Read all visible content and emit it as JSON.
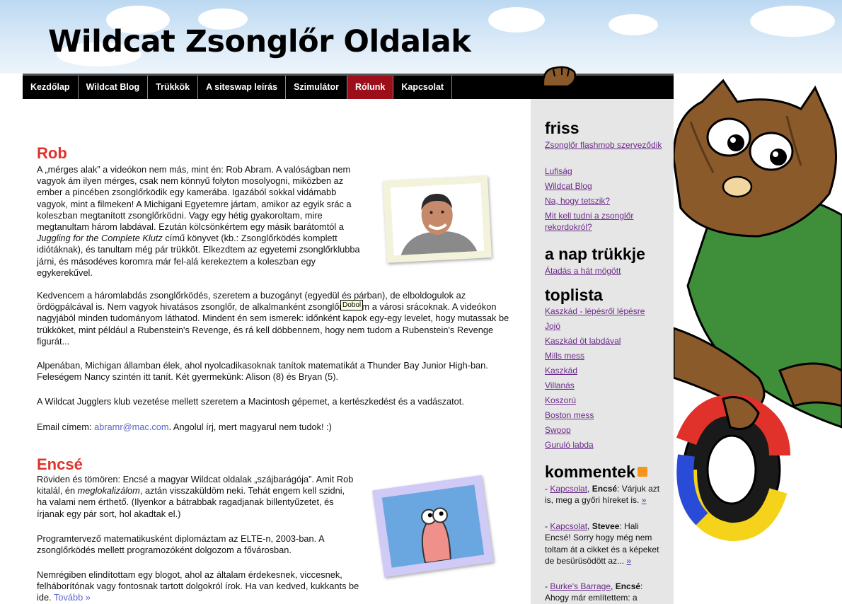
{
  "header": {
    "site_title": "Wildcat Zsonglőr Oldalak"
  },
  "nav": {
    "items": [
      {
        "label": "Kezdőlap",
        "active": false
      },
      {
        "label": "Wildcat Blog",
        "active": false
      },
      {
        "label": "Trükkök",
        "active": false
      },
      {
        "label": "A siteswap leírás",
        "active": false
      },
      {
        "label": "Szimulátor",
        "active": false
      },
      {
        "label": "Rólunk",
        "active": true
      },
      {
        "label": "Kapcsolat",
        "active": false
      }
    ],
    "active_color": "#9c0e1a"
  },
  "rob": {
    "title": "Rob",
    "p1_a": "A „mérges alak” a videókon nem más, mint én: Rob Abram. A valóságban nem vagyok ám ilyen mérges, csak nem könnyű folyton mosolyogni, miközben az ember a pincében zsonglőrködik egy kamerába. Igazából sokkal vidámabb vagyok, mint a filmeken! A Michigani Egyetemre jártam, amikor az egyik srác a koleszban megtanított zsonglőrködni. Vagy egy hétig gyakoroltam, mire megtanultam három labdával. Ezután kölcsönkértem egy másik barátomtól a ",
    "p1_book": "Juggling for the Complete Klutz",
    "p1_b": " című könyvet (kb.: Zsonglőrködés komplett idiótáknak), és tanultam még pár trükköt. Elkezdtem az egyetemi zsonglőrklubba járni, és másodéves koromra már fel-alá kerekeztem a koleszban egy egykerekűvel.",
    "p2": "Kedvencem a háromlabdás zsonglőrködés, szeretem a buzogányt (egyedül és párban), de elboldogulok az ördögpálcával is. Nem vagyok hivatásos zsonglőr, de alkalmanként zsonglőrködöm a városi srácoknak. A videókon nagyjából minden tudományom láthatod. Mindent én sem ismerek: időnként kapok egy-egy levelet, hogy mutassak be trükköket, mint például a Rubenstein's Revenge, és rá kell döbbennem, hogy nem tudom a Rubenstein's Revenge figurát...",
    "p3": "Alpenában, Michigan államban élek, ahol nyolcadikasoknak tanítok matematikát a Thunder Bay Junior High-ban. Feleségem Nancy szintén itt tanít. Két gyermekünk: Alison (8) és Bryan (5).",
    "p4": "A Wildcat Jugglers klub vezetése mellett szeretem a Macintosh gépemet, a kertészkedést és a vadászatot.",
    "email_label": "Email címem: ",
    "email": "abramr@mac.com",
    "email_after": ". Angolul írj, mert magyarul nem tudok! :)",
    "tooltip": "Dobol"
  },
  "encse": {
    "title": "Encsé",
    "p1_a": "Röviden és tömören: Encsé a magyar Wildcat oldalak „szájbarágója”. Amit Rob kitalál, én ",
    "p1_em": "meglokalizálom",
    "p1_b": ", aztán visszaküldöm neki. Tehát engem kell szidni, ha valami nem érthető. (Ilyenkor a bátrabbak ragadjanak billentyűzetet, és írjanak egy pár sort, hol akadtak el.)",
    "p2": "Programtervező matematikusként diplomáztam az ELTE-n, 2003-ban. A zsonglőrködés mellett programozóként dolgozom a fővárosban.",
    "p3": "Nemrégiben elindítottam egy blogot, ahol az általam érdekesnek, viccesnek, felháborítónak vagy fontosnak tartott dolgokról írok. Ha van kedved, kukkants be ide. ",
    "more": "Tovább »"
  },
  "sidebar": {
    "friss_title": "friss",
    "friss": [
      "Zsonglőr flashmob szerveződik",
      "Lufiság",
      "Wildcat Blog",
      "Na, hogy tetszik?",
      "Mit kell tudni a zsonglőr rekordokról?"
    ],
    "trick_title": "a nap trükkje",
    "trick": "Átadás a hát mögött",
    "top_title": "toplista",
    "top": [
      "Kaszkád - lépésről lépésre",
      "Jojó",
      "Kaszkád öt labdával",
      "Mills mess",
      "Kaszkád",
      "Villanás",
      "Koszorú",
      "Boston mess",
      "Swoop",
      "Guruló labda"
    ],
    "comments_title": "kommentek",
    "comments": [
      {
        "dash": "- ",
        "link": "Kapcsolat",
        "author": "Encsé",
        "text": "Várjuk azt is, meg a győri híreket is.",
        "more": "»"
      },
      {
        "dash": "- ",
        "link": "Kapcsolat",
        "author": "Stevee",
        "text": "Hali Encsé! Sorry hogy még nem toltam át a cikket és a képeket de besürüsödött az...",
        "more": "»"
      },
      {
        "dash": "- ",
        "link": "Burke's Barrage",
        "author": "Encsé",
        "text": "Ahogy már említettem: a",
        "more": ""
      }
    ]
  },
  "colors": {
    "accent": "#e0312a",
    "sidebar_link": "#6c2a8a",
    "sidebar_bg": "#e6e6e6"
  }
}
